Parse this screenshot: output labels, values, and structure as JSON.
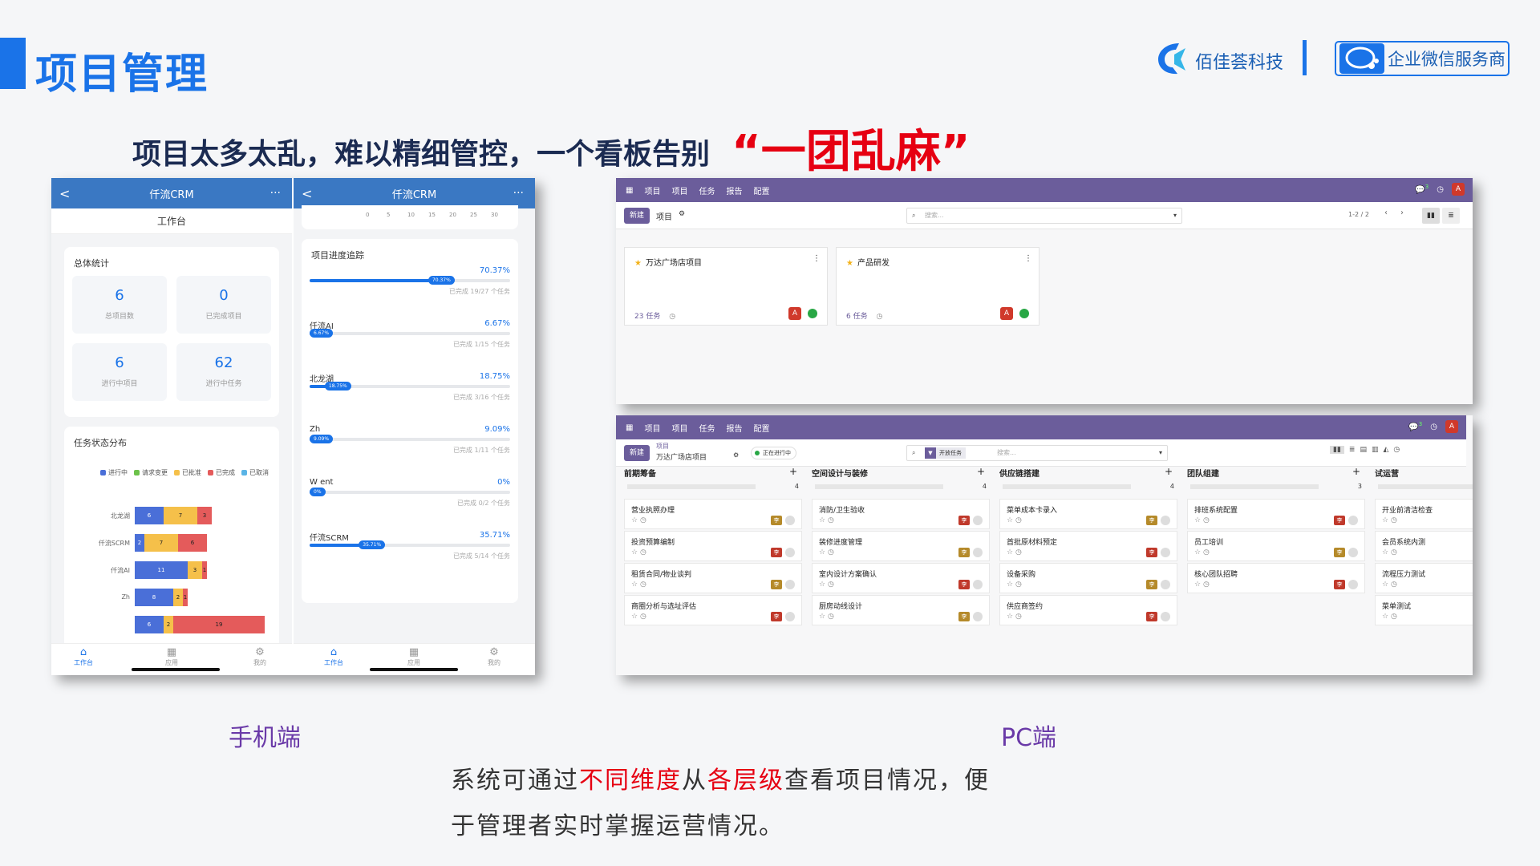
{
  "header": {
    "title": "项目管理",
    "brand_name": "佰佳荟科技",
    "wx_badge": "企业微信服务商"
  },
  "headline": "项目太多太乱，难以精细管控，一个看板告别",
  "headline_accent": "“一团乱麻”",
  "mobile": {
    "app_title": "仟流CRM",
    "back_glyph": "<",
    "more_glyph": "···",
    "tab_title": "工作台",
    "overview_title": "总体统计",
    "stats": [
      {
        "value": "6",
        "label": "总项目数"
      },
      {
        "value": "0",
        "label": "已完成项目"
      },
      {
        "value": "6",
        "label": "进行中项目"
      },
      {
        "value": "62",
        "label": "进行中任务"
      }
    ],
    "task_dist_title": "任务状态分布",
    "legend": [
      {
        "label": "进行中",
        "color": "#4a6fd8"
      },
      {
        "label": "请求变更",
        "color": "#6cc24a"
      },
      {
        "label": "已批准",
        "color": "#f5c04a"
      },
      {
        "label": "已完成",
        "color": "#e45b5b"
      },
      {
        "label": "已取消",
        "color": "#5ab4e6"
      }
    ],
    "bars": [
      {
        "label": "北龙湖",
        "segments": [
          6,
          7,
          3
        ]
      },
      {
        "label": "仟流SCRM",
        "segments": [
          2,
          7,
          6
        ]
      },
      {
        "label": "仟流AI",
        "segments": [
          11,
          3,
          1
        ]
      },
      {
        "label": "Zh",
        "segments": [
          8,
          2,
          1
        ]
      },
      {
        "label": "",
        "segments": [
          6,
          2,
          19
        ]
      }
    ],
    "axis_ticks": [
      "0",
      "5",
      "10",
      "15",
      "20",
      "25",
      "30"
    ],
    "progress_title": "项目进度追踪",
    "progress": [
      {
        "name": "",
        "pct": "70.37%",
        "value": 70.37,
        "sub": "已完成 19/27 个任务"
      },
      {
        "name": "仟流AI",
        "pct": "6.67%",
        "value": 6.67,
        "sub": "已完成 1/15 个任务"
      },
      {
        "name": "北龙湖",
        "pct": "18.75%",
        "value": 18.75,
        "sub": "已完成 3/16 个任务"
      },
      {
        "name": "Zh",
        "pct": "9.09%",
        "value": 9.09,
        "sub": "已完成 1/11 个任务"
      },
      {
        "name": "W  ent",
        "pct": "0%",
        "value": 0,
        "sub": "已完成 0/2 个任务"
      },
      {
        "name": "仟流SCRM",
        "pct": "35.71%",
        "value": 35.71,
        "sub": "已完成 5/14 个任务"
      }
    ],
    "nav": [
      "工作台",
      "应用",
      "我的"
    ]
  },
  "pc": {
    "menu": [
      "项目",
      "项目",
      "任务",
      "报告",
      "配置"
    ],
    "new_button": "新建",
    "breadcrumb": "项目",
    "search_placeholder": "搜索...",
    "pager": "1-2 / 2",
    "projects": [
      {
        "name": "万达广场店项目",
        "tasks": "23 任务"
      },
      {
        "name": "产品研发",
        "tasks": "6 任务"
      }
    ],
    "avatar_letter": "A",
    "chat_count": "3",
    "kanban_breadcrumb_top": "项目",
    "kanban_breadcrumb": "万达广场店项目",
    "kanban_status": "正在进行中",
    "kanban_filter": "开放任务",
    "columns": [
      {
        "title": "前期筹备",
        "count": "4",
        "tasks": [
          "营业执照办理",
          "投资预算编制",
          "租赁合同/物业谈判",
          "商圈分析与选址评估"
        ]
      },
      {
        "title": "空间设计与装修",
        "count": "4",
        "tasks": [
          "消防/卫生验收",
          "装修进度管理",
          "室内设计方案确认",
          "厨房动线设计"
        ]
      },
      {
        "title": "供应链搭建",
        "count": "4",
        "tasks": [
          "菜单成本卡录入",
          "首批原材料预定",
          "设备采购",
          "供应商签约"
        ]
      },
      {
        "title": "团队组建",
        "count": "3",
        "tasks": [
          "排班系统配置",
          "员工培训",
          "核心团队招聘"
        ]
      },
      {
        "title": "试运营",
        "count": "",
        "tasks": [
          "开业前清洁检查",
          "会员系统内测",
          "流程压力测试",
          "菜单测试"
        ]
      }
    ],
    "badge_letter": "李"
  },
  "captions": {
    "mobile": "手机端",
    "pc": "PC端"
  },
  "description": {
    "p1": "系统可通过",
    "p2": "不同维度",
    "p3": "从",
    "p4": "各层级",
    "p5": "查看项目情况，便",
    "line2": "于管理者实时掌握运营情况。"
  }
}
